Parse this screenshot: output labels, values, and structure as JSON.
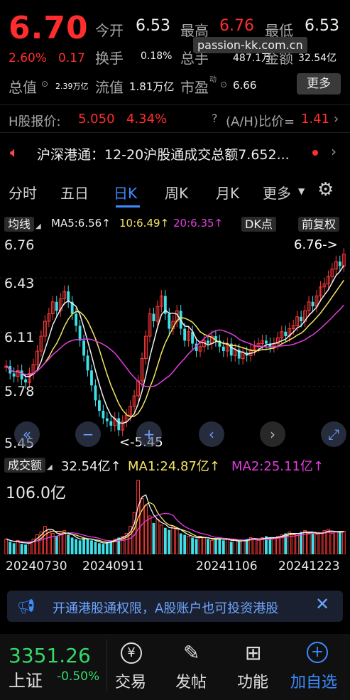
{
  "quote": {
    "price": "6.70",
    "change_pct": "2.60%",
    "change": "0.17",
    "open_label": "今开",
    "open": "6.53",
    "high_label": "最高",
    "high": "6.76",
    "low_label": "最低",
    "low": "6.53",
    "turnover_label": "换手",
    "turnover": "0.18%",
    "volume_label": "总手",
    "volume": "487.1万",
    "amount_label": "金额",
    "amount": "32.54亿",
    "mcap_label": "总值",
    "mcap": "2.39万亿",
    "float_label": "流值",
    "float": "1.81万亿",
    "pe_label": "市盈",
    "pe_sup": "动",
    "pe": "6.66",
    "more": "更多"
  },
  "watermark": "passion-kk.com.cn",
  "hshare": {
    "label": "H股报价:",
    "price": "5.050",
    "pct": "4.34%",
    "ratio_label": "(A/H)比价=",
    "ratio": "1.41"
  },
  "notice": {
    "text": "沪深港通：12-20沪股通成交总额7.652..."
  },
  "tabs": [
    "分时",
    "五日",
    "日K",
    "周K",
    "月K",
    "更多"
  ],
  "active_tab": "日K",
  "ma_bar": {
    "mode": "均线",
    "ma5": "MA5:6.56↑",
    "ma10": "10:6.49↑",
    "ma20": "20:6.35↑",
    "dk": "DK点",
    "adj": "前复权"
  },
  "volume_bar": {
    "mode": "成交额",
    "amount": "32.54亿↑",
    "ma1": "MA1:24.87亿↑",
    "ma2": "MA2:25.11亿↑",
    "max_label": "106.0亿"
  },
  "banner": {
    "text": "开通港股通权限，A股账户也可投资港股"
  },
  "index": {
    "value": "3351.26",
    "name": "上证",
    "pct": "-0.50%"
  },
  "nav": [
    {
      "label": "交易",
      "icon": "yuan-icon"
    },
    {
      "label": "发帖",
      "icon": "edit-icon"
    },
    {
      "label": "功能",
      "icon": "grid-icon"
    },
    {
      "label": "加自选",
      "icon": "plus-circle-icon"
    }
  ],
  "chart_data": {
    "type": "candlestick",
    "y_ticks": [
      "6.76",
      "6.43",
      "6.11",
      "5.78",
      "5.45"
    ],
    "ylim": [
      5.45,
      6.76
    ],
    "x_ticks": [
      "20240730",
      "20240911",
      "20241106",
      "20241223"
    ],
    "high_marker": "6.76->",
    "low_marker": "<-5.45",
    "close": [
      5.95,
      5.9,
      5.88,
      5.92,
      5.86,
      5.84,
      5.9,
      5.96,
      6.05,
      6.15,
      6.25,
      6.3,
      6.38,
      6.32,
      6.4,
      6.45,
      6.38,
      6.3,
      6.22,
      6.12,
      6.02,
      5.92,
      5.82,
      5.72,
      5.65,
      5.6,
      5.58,
      5.55,
      5.6,
      5.52,
      5.58,
      5.62,
      5.68,
      5.75,
      5.85,
      6.0,
      6.15,
      6.3,
      6.25,
      6.35,
      6.42,
      6.3,
      6.2,
      6.25,
      6.32,
      6.2,
      6.12,
      6.18,
      6.1,
      6.05,
      6.08,
      6.12,
      6.1,
      6.15,
      6.12,
      6.08,
      6.05,
      6.1,
      6.02,
      6.06,
      6.0,
      6.04,
      6.02,
      6.06,
      6.08,
      6.1,
      6.12,
      6.1,
      6.08,
      6.1,
      6.14,
      6.18,
      6.15,
      6.2,
      6.22,
      6.28,
      6.25,
      6.32,
      6.38,
      6.35,
      6.42,
      6.48,
      6.5,
      6.55,
      6.6,
      6.65,
      6.62,
      6.7
    ],
    "volume": [
      22,
      18,
      16,
      20,
      15,
      14,
      18,
      22,
      28,
      32,
      40,
      36,
      30,
      26,
      30,
      34,
      28,
      24,
      22,
      20,
      24,
      22,
      20,
      18,
      16,
      15,
      18,
      20,
      22,
      24,
      26,
      30,
      40,
      60,
      106,
      80,
      70,
      55,
      45,
      50,
      42,
      38,
      35,
      40,
      36,
      30,
      28,
      26,
      24,
      22,
      26,
      24,
      22,
      20,
      22,
      24,
      20,
      22,
      18,
      20,
      18,
      20,
      22,
      24,
      22,
      20,
      24,
      26,
      22,
      24,
      26,
      28,
      30,
      32,
      28,
      30,
      32,
      34,
      30,
      32,
      28,
      30,
      34,
      36,
      30,
      32,
      33,
      33
    ]
  }
}
